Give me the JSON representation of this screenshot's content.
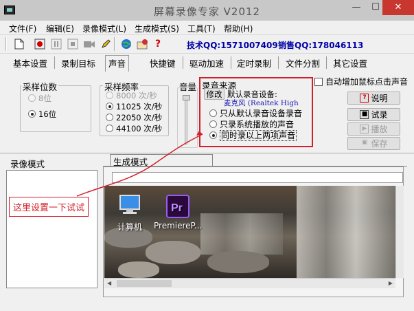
{
  "window": {
    "title": "屏幕录像专家 V2012",
    "minimize": "—",
    "maximize": "☐",
    "close": "✕"
  },
  "menu": [
    "文件(F)",
    "编辑(E)",
    "录像模式(L)",
    "生成模式(S)",
    "工具(T)",
    "帮助(H)"
  ],
  "toolbar": {
    "icons": [
      "new-file-icon",
      "record-icon",
      "pause-icon",
      "stop-icon",
      "camera-icon",
      "pen-icon",
      "globe-icon",
      "settings-icon",
      "help-icon"
    ],
    "tech_qq": "技术QQ:1571007409",
    "sales_qq": "销售QQ:178046113"
  },
  "tabs": [
    "基本设置",
    "录制目标",
    "声音",
    "快捷键",
    "驱动加速",
    "定时录制",
    "文件分割",
    "其它设置"
  ],
  "active_tab": "声音",
  "sample_bits": {
    "label": "采样位数",
    "options": [
      {
        "label": "8位",
        "selected": false,
        "disabled": true
      },
      {
        "label": "16位",
        "selected": true,
        "disabled": false
      }
    ]
  },
  "sample_rate": {
    "label": "采样频率",
    "options": [
      {
        "label": "8000 次/秒",
        "selected": false,
        "disabled": true
      },
      {
        "label": "11025 次/秒",
        "selected": true,
        "disabled": false
      },
      {
        "label": "22050 次/秒",
        "selected": false,
        "disabled": false
      },
      {
        "label": "44100 次/秒",
        "selected": false,
        "disabled": false
      }
    ]
  },
  "volume": {
    "label": "音量"
  },
  "audio_source": {
    "label": "录音来源",
    "modify_button": "修改",
    "default_device_label": "默认录音设备:",
    "device_name": "麦克风 (Realtek High",
    "options": [
      {
        "label": "只从默认录音设备录音",
        "selected": false
      },
      {
        "label": "只录系统播放的声音",
        "selected": false
      },
      {
        "label": "同时录以上两项声音",
        "selected": true
      }
    ]
  },
  "auto_click_sound": {
    "label": "自动增加鼠标点击声音",
    "checked": false
  },
  "buttons": {
    "help": "说明",
    "test_record": "试录",
    "play": "播放",
    "save": "保存"
  },
  "record_mode_panel": {
    "label": "录像模式"
  },
  "generate_mode_tab": {
    "label": "生成模式"
  },
  "annotation": {
    "text": "这里设置一下试试"
  },
  "desktop": {
    "icons": [
      {
        "label": "计算机",
        "icon": "computer-icon"
      },
      {
        "label": "PremiereP...",
        "icon": "premiere-icon"
      }
    ]
  },
  "colors": {
    "accent_red": "#d0202a",
    "qq_blue": "#0000a8",
    "device_blue": "#1a1ab0",
    "close_red": "#c7372f"
  }
}
